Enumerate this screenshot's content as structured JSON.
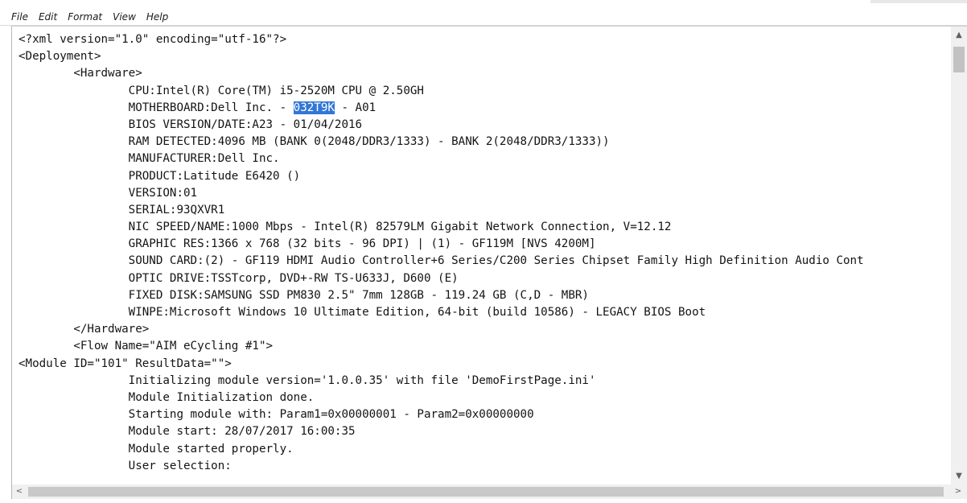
{
  "menu": {
    "file": "File",
    "edit": "Edit",
    "format": "Format",
    "view": "View",
    "help": "Help"
  },
  "document": {
    "selected_text": "032T9K",
    "lines": [
      "<?xml version=\"1.0\" encoding=\"utf-16\"?>",
      "<Deployment>",
      "        <Hardware>",
      "                CPU:Intel(R) Core(TM) i5-2520M CPU @ 2.50GH",
      "                MOTHERBOARD:Dell Inc. - 032T9K - A01",
      "                BIOS VERSION/DATE:A23 - 01/04/2016",
      "                RAM DETECTED:4096 MB (BANK 0(2048/DDR3/1333) - BANK 2(2048/DDR3/1333))",
      "                MANUFACTURER:Dell Inc.",
      "                PRODUCT:Latitude E6420 ()",
      "                VERSION:01",
      "                SERIAL:93QXVR1",
      "                NIC SPEED/NAME:1000 Mbps - Intel(R) 82579LM Gigabit Network Connection, V=12.12",
      "                GRAPHIC RES:1366 x 768 (32 bits - 96 DPI) | (1) - GF119M [NVS 4200M]",
      "                SOUND CARD:(2) - GF119 HDMI Audio Controller+6 Series/C200 Series Chipset Family High Definition Audio Cont",
      "                OPTIC DRIVE:TSSTcorp, DVD+-RW TS-U633J, D600 (E)",
      "                FIXED DISK:SAMSUNG SSD PM830 2.5\" 7mm 128GB - 119.24 GB (C,D - MBR)",
      "                WINPE:Microsoft Windows 10 Ultimate Edition, 64-bit (build 10586) - LEGACY BIOS Boot",
      "        </Hardware>",
      "        <Flow Name=\"AIM eCycling #1\">",
      "<Module ID=\"101\" ResultData=\"\">",
      "                Initializing module version='1.0.0.35' with file 'DemoFirstPage.ini'",
      "                Module Initialization done.",
      "                Starting module with: Param1=0x00000001 - Param2=0x00000000",
      "                Module start: 28/07/2017 16:00:35",
      "                Module started properly.",
      "                User selection:"
    ]
  },
  "scrollbars": {
    "up_icon": "▲",
    "down_icon": "▼",
    "left_icon": "<",
    "right_icon": ">"
  }
}
